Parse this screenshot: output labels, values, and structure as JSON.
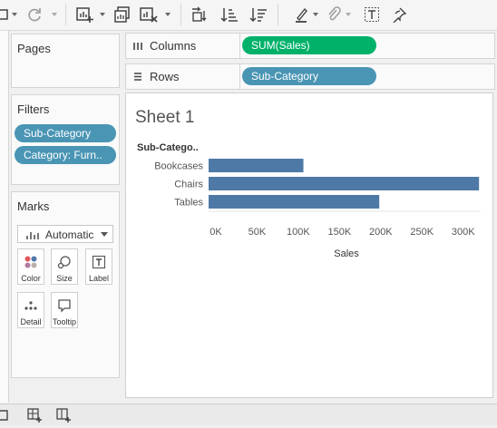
{
  "app": {
    "toolbar_icons": [
      "worksheet-icon",
      "refresh-icon",
      "new-worksheet-icon",
      "duplicate-icon",
      "clear-sheet-icon",
      "swap-icon",
      "sort-ascending-icon",
      "sort-descending-icon",
      "highlight-icon",
      "attach-icon",
      "text-label-icon",
      "pin-icon"
    ]
  },
  "pages_card": {
    "title": "Pages"
  },
  "filters_card": {
    "title": "Filters",
    "pills": [
      "Sub-Category",
      "Category: Furn.."
    ]
  },
  "marks_card": {
    "title": "Marks",
    "mark_type": "Automatic",
    "buttons": [
      "Color",
      "Size",
      "Label",
      "Detail",
      "Tooltip"
    ]
  },
  "columns_shelf": {
    "label": "Columns",
    "pill": "SUM(Sales)",
    "pill_color": "#00b16a"
  },
  "rows_shelf": {
    "label": "Rows",
    "pill": "Sub-Category",
    "pill_color": "#4a95b4"
  },
  "sheet": {
    "title": "Sheet 1",
    "row_header": "Sub-Catego..",
    "bar_color": "#4e79a7"
  },
  "chart_data": {
    "type": "bar",
    "orientation": "horizontal",
    "categories": [
      "Bookcases",
      "Chairs",
      "Tables"
    ],
    "values": [
      115000,
      328000,
      207000
    ],
    "xlabel": "Sales",
    "ylabel": "Sub-Catego..",
    "xlim": [
      0,
      330000
    ],
    "ticks": [
      0,
      50000,
      100000,
      150000,
      200000,
      250000,
      300000
    ],
    "tick_labels": [
      "0K",
      "50K",
      "100K",
      "150K",
      "200K",
      "250K",
      "300K"
    ],
    "grid": false
  }
}
